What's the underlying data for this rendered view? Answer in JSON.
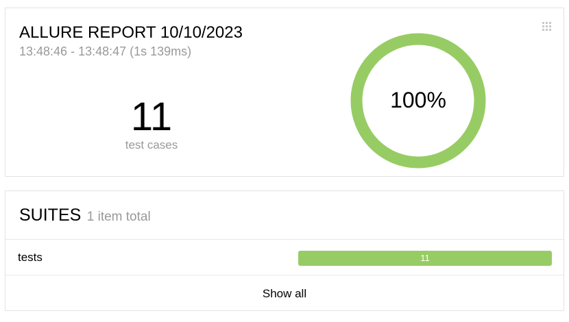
{
  "summary": {
    "title": "ALLURE REPORT 10/10/2023",
    "time_range": "13:48:46 - 13:48:47 (1s 139ms)",
    "test_count": "11",
    "test_count_label": "test cases",
    "pass_rate_text": "100%",
    "pass_rate_fraction": 1.0,
    "donut_color": "#97cc64"
  },
  "suites": {
    "title": "SUITES",
    "total_text": "1 item total",
    "items": [
      {
        "name": "tests",
        "passed": "11",
        "bar_color": "#97cc64"
      }
    ],
    "show_all_label": "Show all"
  },
  "icons": {
    "widget_menu": "grip-icon"
  }
}
